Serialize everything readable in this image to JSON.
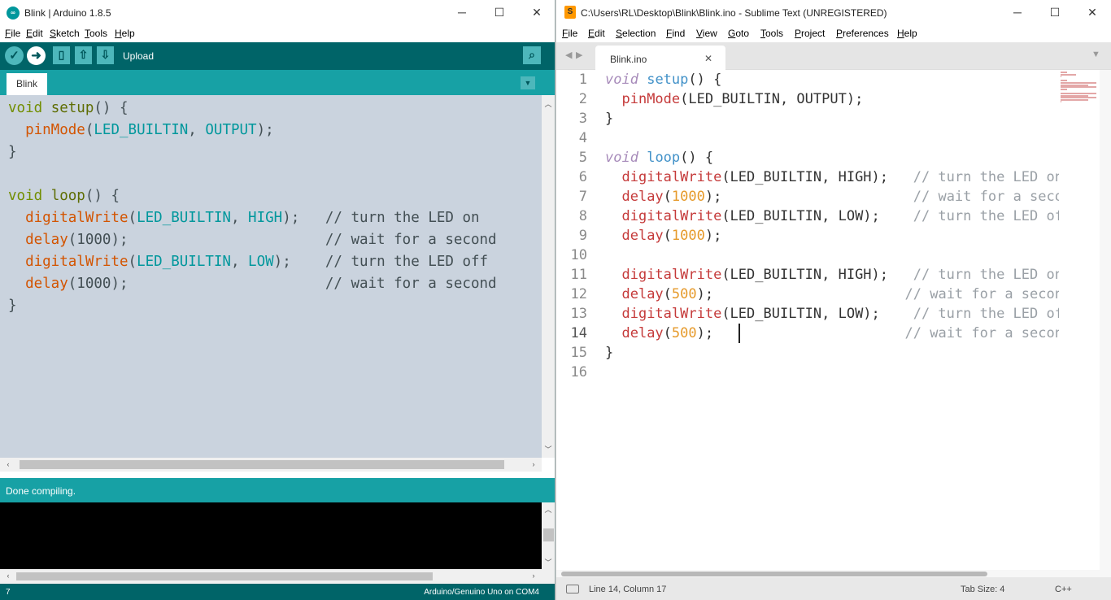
{
  "arduino": {
    "title": "Blink | Arduino 1.8.5",
    "menu": [
      "File",
      "Edit",
      "Sketch",
      "Tools",
      "Help"
    ],
    "toolbar_hover_label": "Upload",
    "tab": "Blink",
    "code": [
      [
        {
          "t": "void",
          "c": "kw"
        },
        {
          "t": " "
        },
        {
          "t": "setup",
          "c": "fn"
        },
        {
          "t": "() {"
        }
      ],
      [
        {
          "t": "  "
        },
        {
          "t": "pinMode",
          "c": "call"
        },
        {
          "t": "("
        },
        {
          "t": "LED_BUILTIN",
          "c": "const"
        },
        {
          "t": ", "
        },
        {
          "t": "OUTPUT",
          "c": "const"
        },
        {
          "t": ");"
        }
      ],
      [
        {
          "t": "}"
        }
      ],
      [
        {
          "t": ""
        }
      ],
      [
        {
          "t": "void",
          "c": "kw"
        },
        {
          "t": " "
        },
        {
          "t": "loop",
          "c": "fn"
        },
        {
          "t": "() {"
        }
      ],
      [
        {
          "t": "  "
        },
        {
          "t": "digitalWrite",
          "c": "call"
        },
        {
          "t": "("
        },
        {
          "t": "LED_BUILTIN",
          "c": "const"
        },
        {
          "t": ", "
        },
        {
          "t": "HIGH",
          "c": "const"
        },
        {
          "t": ");   "
        },
        {
          "t": "// turn the LED on",
          "c": "cm"
        }
      ],
      [
        {
          "t": "  "
        },
        {
          "t": "delay",
          "c": "call"
        },
        {
          "t": "(1000);                       "
        },
        {
          "t": "// wait for a second",
          "c": "cm"
        }
      ],
      [
        {
          "t": "  "
        },
        {
          "t": "digitalWrite",
          "c": "call"
        },
        {
          "t": "("
        },
        {
          "t": "LED_BUILTIN",
          "c": "const"
        },
        {
          "t": ", "
        },
        {
          "t": "LOW",
          "c": "const"
        },
        {
          "t": ");    "
        },
        {
          "t": "// turn the LED off",
          "c": "cm"
        }
      ],
      [
        {
          "t": "  "
        },
        {
          "t": "delay",
          "c": "call"
        },
        {
          "t": "(1000);                       "
        },
        {
          "t": "// wait for a second",
          "c": "cm"
        }
      ],
      [
        {
          "t": "}"
        }
      ]
    ],
    "status": "Done compiling.",
    "line_number": "7",
    "board": "Arduino/Genuino Uno on COM4"
  },
  "sublime": {
    "title": "C:\\Users\\RL\\Desktop\\Blink\\Blink.ino - Sublime Text (UNREGISTERED)",
    "menu": [
      "File",
      "Edit",
      "Selection",
      "Find",
      "View",
      "Goto",
      "Tools",
      "Project",
      "Preferences",
      "Help"
    ],
    "tab": "Blink.ino",
    "line_numbers": [
      "1",
      "2",
      "3",
      "4",
      "5",
      "6",
      "7",
      "8",
      "9",
      "10",
      "11",
      "12",
      "13",
      "14",
      "15",
      "16"
    ],
    "code": [
      [
        {
          "t": "void",
          "c": "skw"
        },
        {
          "t": " "
        },
        {
          "t": "setup",
          "c": "sfn"
        },
        {
          "t": "() {"
        }
      ],
      [
        {
          "t": "  "
        },
        {
          "t": "pinMode",
          "c": "scall"
        },
        {
          "t": "(LED_BUILTIN, OUTPUT);"
        }
      ],
      [
        {
          "t": "}"
        }
      ],
      [
        {
          "t": ""
        }
      ],
      [
        {
          "t": "void",
          "c": "skw"
        },
        {
          "t": " "
        },
        {
          "t": "loop",
          "c": "sfn"
        },
        {
          "t": "() {"
        }
      ],
      [
        {
          "t": "  "
        },
        {
          "t": "digitalWrite",
          "c": "scall"
        },
        {
          "t": "(LED_BUILTIN, HIGH);   "
        },
        {
          "t": "// turn the LED on (HIGH is the voltage level)",
          "c": "scm"
        }
      ],
      [
        {
          "t": "  "
        },
        {
          "t": "delay",
          "c": "scall"
        },
        {
          "t": "("
        },
        {
          "t": "1000",
          "c": "snum"
        },
        {
          "t": ");                       "
        },
        {
          "t": "// wait for a second",
          "c": "scm"
        }
      ],
      [
        {
          "t": "  "
        },
        {
          "t": "digitalWrite",
          "c": "scall"
        },
        {
          "t": "(LED_BUILTIN, LOW);    "
        },
        {
          "t": "// turn the LED off by making the voltage LOW",
          "c": "scm"
        }
      ],
      [
        {
          "t": "  "
        },
        {
          "t": "delay",
          "c": "scall"
        },
        {
          "t": "("
        },
        {
          "t": "1000",
          "c": "snum"
        },
        {
          "t": ");"
        }
      ],
      [
        {
          "t": ""
        }
      ],
      [
        {
          "t": "  "
        },
        {
          "t": "digitalWrite",
          "c": "scall"
        },
        {
          "t": "(LED_BUILTIN, HIGH);   "
        },
        {
          "t": "// turn the LED on (HIGH is the voltage level)",
          "c": "scm"
        }
      ],
      [
        {
          "t": "  "
        },
        {
          "t": "delay",
          "c": "scall"
        },
        {
          "t": "("
        },
        {
          "t": "500",
          "c": "snum"
        },
        {
          "t": ");                       "
        },
        {
          "t": "// wait for a second",
          "c": "scm"
        }
      ],
      [
        {
          "t": "  "
        },
        {
          "t": "digitalWrite",
          "c": "scall"
        },
        {
          "t": "(LED_BUILTIN, LOW);    "
        },
        {
          "t": "// turn the LED off by making the voltage LOW",
          "c": "scm"
        }
      ],
      [
        {
          "t": "  "
        },
        {
          "t": "delay",
          "c": "scall"
        },
        {
          "t": "("
        },
        {
          "t": "500",
          "c": "snum"
        },
        {
          "t": ");                       "
        },
        {
          "t": "// wait for a second",
          "c": "scm"
        }
      ],
      [
        {
          "t": "}"
        }
      ],
      [
        {
          "t": ""
        }
      ]
    ],
    "status_position": "Line 14, Column 17",
    "status_tabsize": "Tab Size: 4",
    "status_syntax": "C++"
  },
  "colors": {
    "kw": "#728e00",
    "fn": "#5e6d03",
    "call": "#d35400",
    "const": "#00979c",
    "cm": "#434f54",
    "skw": "#a78bba",
    "sfn": "#4191c8",
    "scall": "#c53a3a",
    "snum": "#e69a2b",
    "scm": "#9aa0a6"
  }
}
